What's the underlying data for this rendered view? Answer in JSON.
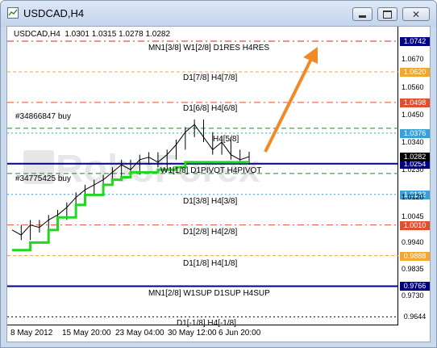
{
  "window": {
    "title": "USDCAD,H4"
  },
  "chart": {
    "ohlc_line": "USDCAD,H4  1.0301 1.0315 1.0278 1.0282",
    "orders": [
      {
        "label": "#34866847 buy"
      },
      {
        "label": "#34775425 buy"
      }
    ],
    "watermark": "RoboForex"
  },
  "levels": [
    {
      "label": "MN1[3/8] W1[2/8] D1RES H4RES",
      "color": "#d3261e"
    },
    {
      "label": "D1[7/8] H4[7/8]",
      "color": "#f0a830"
    },
    {
      "label": "D1[6/8] H4[6/8]",
      "color": "#e05030"
    },
    {
      "label": "H4[5/8]",
      "color": "#3aa0d8"
    },
    {
      "label": "W1[1/8] D1PIVOT H4PIVOT",
      "color": "#000080"
    },
    {
      "label": "D1[3/8] H4[3/8]",
      "color": "#3aa0d8"
    },
    {
      "label": "D1[2/8] H4[2/8]",
      "color": "#e05030"
    },
    {
      "label": "D1[1/8] H4[1/8]",
      "color": "#f0a830"
    },
    {
      "label": "MN1[2/8] W1SUP D1SUP H4SUP",
      "color": "#000080"
    },
    {
      "label": "D1[-1/8] H4[-1/8]",
      "color": "#000"
    }
  ],
  "price_axis": {
    "ticks": [
      "1.0742",
      "1.0620",
      "1.0498",
      "1.0376",
      "1.0254",
      "1.0132",
      "1.0010",
      "0.9888",
      "0.9766",
      "0.9644",
      "1.0670",
      "1.0560",
      "1.0450",
      "1.0340",
      "1.0282",
      "1.0230",
      "1.0120",
      "1.0045",
      "0.9940",
      "0.9835",
      "0.9730"
    ]
  },
  "time_axis": {
    "labels": [
      "8 May 2012",
      "15 May 20:00",
      "23 May 04:00",
      "30 May 12:00",
      "6 Jun 20:00"
    ]
  },
  "arrow": {
    "direction": "up",
    "color": "#f08a28"
  },
  "chart_data": {
    "type": "line",
    "series": [
      {
        "values": [
          0.999,
          0.997,
          1.001,
          1.0,
          1.003,
          1.005,
          1.008,
          1.012,
          1.015,
          1.017,
          1.019,
          1.022,
          1.025,
          1.023,
          1.027,
          1.028,
          1.026,
          1.029,
          1.033,
          1.038,
          1.041,
          1.036,
          1.031,
          1.034,
          1.029,
          1.027,
          1.0282
        ]
      },
      {
        "values": [
          0.991,
          0.991,
          0.994,
          0.994,
          0.999,
          1.004,
          1.004,
          1.009,
          1.013,
          1.013,
          1.017,
          1.019,
          1.02,
          1.022,
          1.022,
          1.022,
          1.023,
          1.023,
          1.024,
          1.026,
          1.026,
          1.026,
          1.026,
          1.026,
          1.026,
          1.026,
          1.026
        ]
      }
    ],
    "ylim": [
      0.961,
      1.08
    ]
  }
}
